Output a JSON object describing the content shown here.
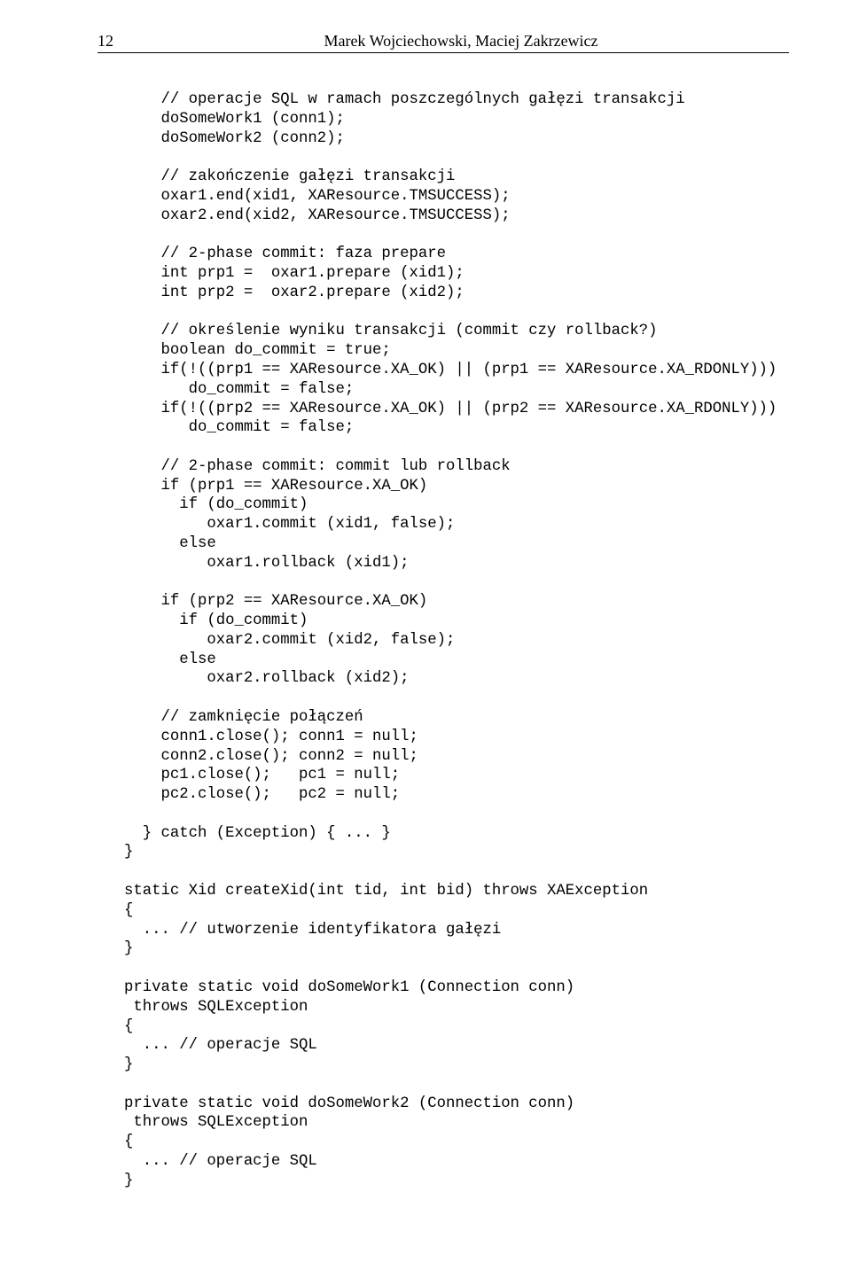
{
  "header": {
    "page_number": "12",
    "authors": "Marek Wojciechowski, Maciej Zakrzewicz"
  },
  "code": "    // operacje SQL w ramach poszczególnych gałęzi transakcji\n    doSomeWork1 (conn1);\n    doSomeWork2 (conn2);\n\n    // zakończenie gałęzi transakcji\n    oxar1.end(xid1, XAResource.TMSUCCESS);\n    oxar2.end(xid2, XAResource.TMSUCCESS);\n\n    // 2-phase commit: faza prepare\n    int prp1 =  oxar1.prepare (xid1);\n    int prp2 =  oxar2.prepare (xid2);\n\n    // określenie wyniku transakcji (commit czy rollback?)\n    boolean do_commit = true;\n    if(!((prp1 == XAResource.XA_OK) || (prp1 == XAResource.XA_RDONLY)))\n       do_commit = false;\n    if(!((prp2 == XAResource.XA_OK) || (prp2 == XAResource.XA_RDONLY)))\n       do_commit = false;\n\n    // 2-phase commit: commit lub rollback\n    if (prp1 == XAResource.XA_OK)\n      if (do_commit)\n         oxar1.commit (xid1, false);\n      else\n         oxar1.rollback (xid1);\n\n    if (prp2 == XAResource.XA_OK)\n      if (do_commit)\n         oxar2.commit (xid2, false);\n      else\n         oxar2.rollback (xid2);\n\n    // zamknięcie połączeń\n    conn1.close(); conn1 = null;\n    conn2.close(); conn2 = null;\n    pc1.close();   pc1 = null;\n    pc2.close();   pc2 = null;\n\n  } catch (Exception) { ... }\n}\n\nstatic Xid createXid(int tid, int bid) throws XAException\n{\n  ... // utworzenie identyfikatora gałęzi\n}\n\nprivate static void doSomeWork1 (Connection conn)\n throws SQLException\n{\n  ... // operacje SQL\n}\n\nprivate static void doSomeWork2 (Connection conn)\n throws SQLException\n{\n  ... // operacje SQL\n}"
}
